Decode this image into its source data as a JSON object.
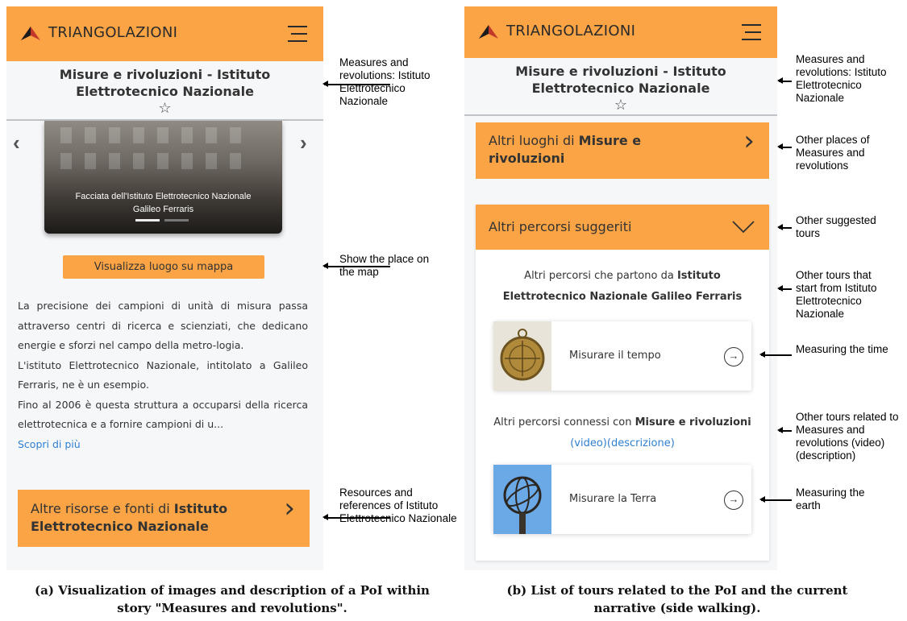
{
  "app": {
    "brand": "TRIANGOLAZIONI"
  },
  "poi_title": "Misure e rivoluzioni - Istituto Elettrotecnico Nazionale",
  "screen_a": {
    "carousel_caption": "Facciata dell'Istituto Elettrotecnico Nazionale Galileo Ferraris",
    "map_button": "Visualizza luogo su mappa",
    "description": [
      "La precisione dei campioni di unità di misura passa attraverso centri di ricerca e scienziati, che dedicano energie e sforzi nel campo della metro-logia.",
      "L'istituto Elettrotecnico Nazionale, intitolato a Galileo Ferraris, ne è un esempio.",
      "Fino al 2006 è questa struttura a occuparsi della ricerca elettrotecnica e a fornire campioni di u..."
    ],
    "read_more": "Scopri di più",
    "resources_prefix": "Altre risorse e fonti di ",
    "resources_bold": "Istituto Elettrotecnico Nazionale"
  },
  "screen_b": {
    "other_places_prefix": "Altri luoghi di ",
    "other_places_bold": "Misure e rivoluzioni",
    "suggested_tours": "Altri percorsi suggeriti",
    "start_prefix": "Altri percorsi che partono da ",
    "start_bold": "Istituto Elettrotecnico Nazionale Galileo Ferraris",
    "tour1": "Misurare il tempo",
    "connected_prefix": "Altri percorsi connessi con ",
    "connected_bold": "Misure e rivoluzioni",
    "connected_links": "(video)(descrizione)",
    "tour2": "Misurare la Terra"
  },
  "annotations": {
    "a_title": "Measures and revolutions: Istituto Elettrotecnico Nazionale",
    "a_map": "Show the place on the map",
    "a_resources": "Resources and references of Istituto Elettrotecnico Nazionale",
    "b_title": "Measures and revolutions: Istituto Elettrotecnico Nazionale",
    "b_places": "Other places of Measures and revolutions",
    "b_suggested": "Other suggested tours",
    "b_start": "Other tours that start from Istituto Elettrotecnico Nazionale",
    "b_time": "Measuring the time",
    "b_related": "Other tours related to Measures and revolutions (video) (description)",
    "b_earth": "Measuring the earth"
  },
  "captions": {
    "a": "(a) Visualization of images and description of a PoI within story \"Measures and revolutions\".",
    "b": "(b) List of tours related to the PoI and the current narrative (side walking)."
  },
  "colors": {
    "accent": "#fba445",
    "link": "#2f7fd0",
    "background": "#f6f7f9"
  }
}
